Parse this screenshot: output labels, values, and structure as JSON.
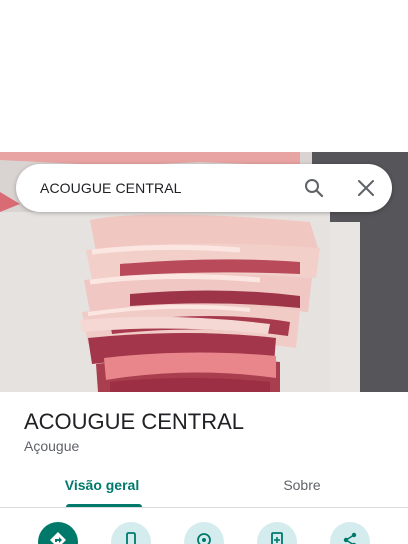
{
  "search": {
    "query": "ACOUGUE CENTRAL"
  },
  "place": {
    "name": "ACOUGUE CENTRAL",
    "category": "Açougue"
  },
  "tabs": [
    {
      "label": "Visão geral",
      "selected": true
    },
    {
      "label": "Sobre",
      "selected": false
    }
  ],
  "actions": [
    {
      "icon": "directions-icon"
    },
    {
      "icon": "phone-icon"
    },
    {
      "icon": "location-icon"
    },
    {
      "icon": "save-icon"
    },
    {
      "icon": "share-icon"
    }
  ],
  "colors": {
    "accent": "#00796b",
    "action_background": "#d5ecef",
    "text_primary": "#202124",
    "text_secondary": "#5f6368"
  }
}
